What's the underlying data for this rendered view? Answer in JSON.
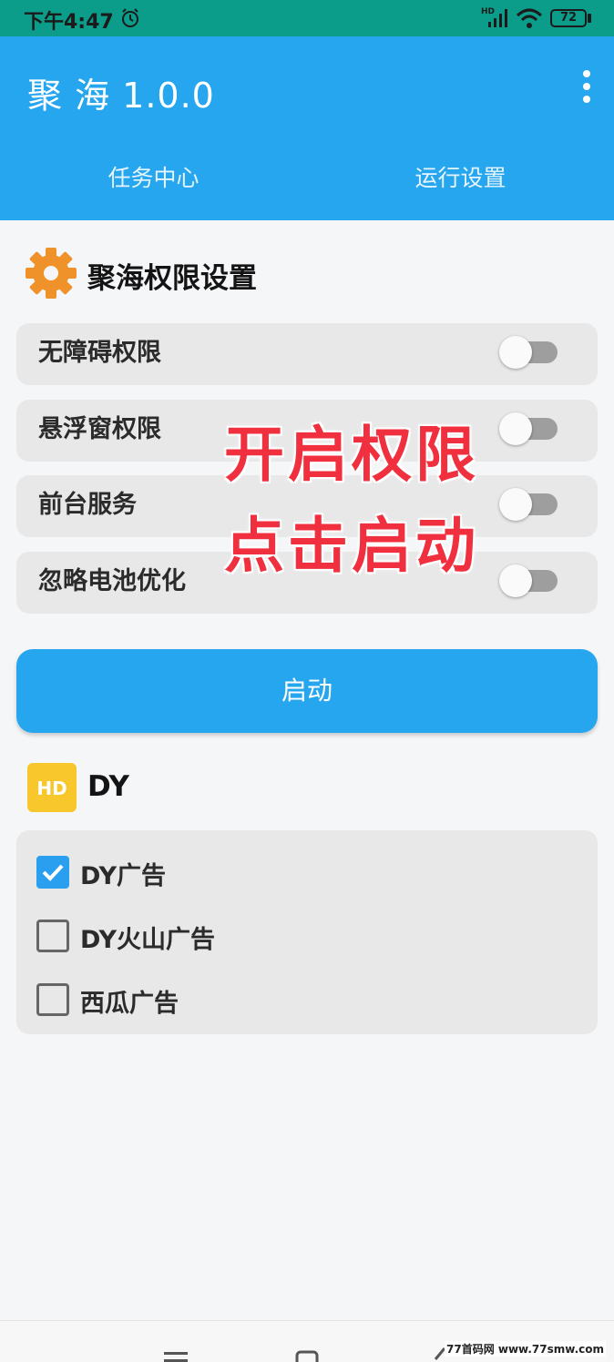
{
  "status_bar": {
    "time": "下午4:47",
    "hd": "HD",
    "battery": "72"
  },
  "app_bar": {
    "title": "聚 海 1.0.0",
    "tabs": [
      {
        "label": "任务中心",
        "selected": false
      },
      {
        "label": "运行设置",
        "selected": true
      }
    ]
  },
  "permissions": {
    "title": "聚海权限设置",
    "items": [
      {
        "label": "无障碍权限",
        "enabled": false
      },
      {
        "label": "悬浮窗权限",
        "enabled": false
      },
      {
        "label": "前台服务",
        "enabled": false
      },
      {
        "label": "忽略电池优化",
        "enabled": false
      }
    ]
  },
  "overlay": {
    "line1": "开启权限",
    "line2": "点击启动"
  },
  "start_button": {
    "label": "启动"
  },
  "dy": {
    "icon_text": "HD",
    "title": "DY",
    "options": [
      {
        "label": "DY广告",
        "checked": true
      },
      {
        "label": "DY火山广告",
        "checked": false
      },
      {
        "label": "西瓜广告",
        "checked": false
      }
    ]
  },
  "watermark": "77首码网 www.77smw.com",
  "colors": {
    "primary": "#26a6ee",
    "status_bar": "#0b9c8a",
    "overlay_red": "#f0303f",
    "gear_orange": "#f0922a",
    "hd_yellow": "#f7c72c"
  }
}
